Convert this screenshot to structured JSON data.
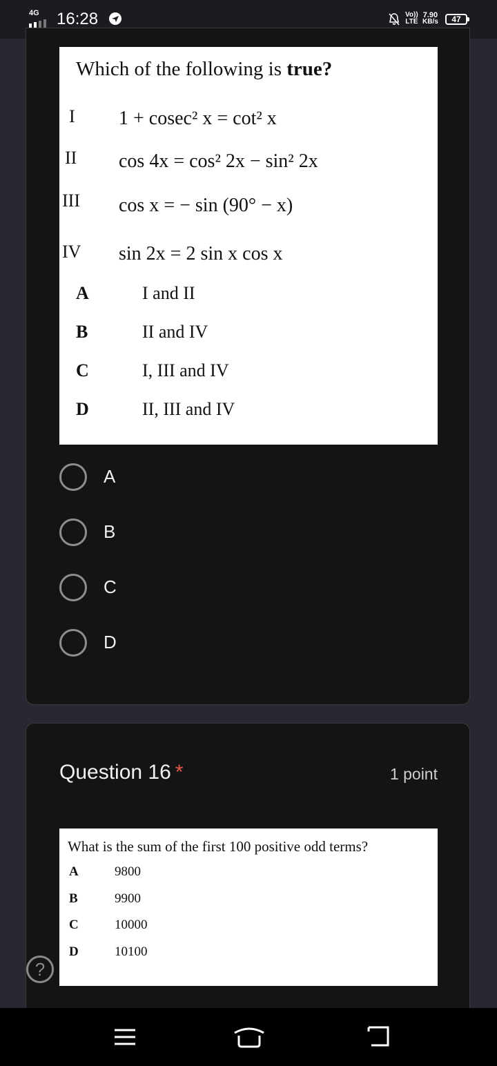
{
  "status_bar": {
    "network": "4G",
    "time": "16:28",
    "volte_top": "Vo))",
    "volte_bottom": "LTE",
    "speed_value": "7.90",
    "speed_unit": "KB/s",
    "battery": "47"
  },
  "question15": {
    "prompt_start": "Which of the following is ",
    "prompt_bold": "true?",
    "statements": [
      {
        "num": "I",
        "text": "1 + cosec² x = cot² x"
      },
      {
        "num": "II",
        "text": "cos 4x = cos² 2x − sin² 2x"
      },
      {
        "num": "III",
        "text": "cos x = − sin (90° − x)"
      },
      {
        "num": "IV",
        "text": "sin 2x = 2 sin x cos x"
      }
    ],
    "options": [
      {
        "letter": "A",
        "text": "I and II"
      },
      {
        "letter": "B",
        "text": "II and IV"
      },
      {
        "letter": "C",
        "text": "I, III and IV"
      },
      {
        "letter": "D",
        "text": "II, III and IV"
      }
    ],
    "choices": [
      "A",
      "B",
      "C",
      "D"
    ]
  },
  "question16": {
    "title": "Question 16",
    "required_mark": "*",
    "points": "1 point",
    "prompt": "What is the sum of the first 100 positive odd terms?",
    "options": [
      {
        "letter": "A",
        "value": "9800"
      },
      {
        "letter": "B",
        "value": "9900"
      },
      {
        "letter": "C",
        "value": "10000"
      },
      {
        "letter": "D",
        "value": "10100"
      }
    ]
  },
  "help_symbol": "?",
  "icons": [
    "telegram-icon",
    "silent-bell-icon",
    "help-icon",
    "recent-apps-icon",
    "home-icon",
    "back-icon"
  ]
}
